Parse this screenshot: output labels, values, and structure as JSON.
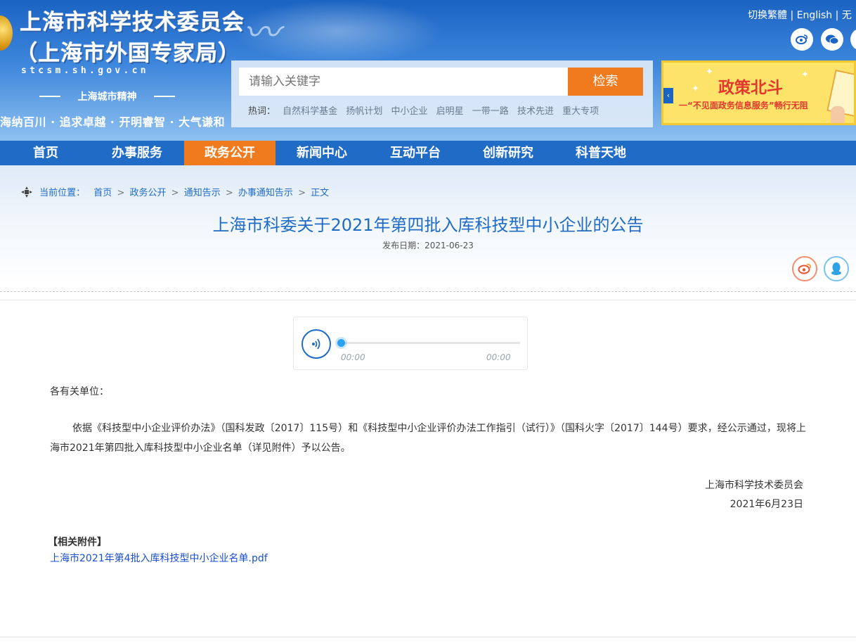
{
  "header": {
    "org_name": "上海市科学技术委员会",
    "org_sub": "（上海市外国专家局）",
    "domain": "stcsm.sh.gov.cn",
    "spirit_title": "上海城市精神",
    "spirit_text": "海纳百川 · 追求卓越 · 开明睿智 · 大气谦和",
    "links": [
      "切换繁體",
      "English",
      "无"
    ],
    "social_icons": [
      "weibo-icon",
      "wechat-icon"
    ]
  },
  "search": {
    "placeholder": "请输入关键字",
    "button_label": "检索",
    "hot_label": "热词：",
    "hot_words": [
      "自然科学基金",
      "扬帆计划",
      "中小企业",
      "启明星",
      "一带一路",
      "技术先进",
      "重大专项"
    ]
  },
  "banner": {
    "title": "政策北斗",
    "subtitle": "一“不见面政务信息服务”畅行无阻"
  },
  "nav": {
    "items": [
      "首页",
      "办事服务",
      "政务公开",
      "新闻中心",
      "互动平台",
      "创新研究",
      "科普天地"
    ],
    "active_index": 2
  },
  "breadcrumb": {
    "label": "当前位置：",
    "items": [
      "首页",
      "政务公开",
      "通知告示",
      "办事通知告示",
      "正文"
    ]
  },
  "article": {
    "title": "上海市科委关于2021年第四批入库科技型中小企业的公告",
    "publish_date": "发布日期：2021-06-23",
    "audio": {
      "current": "00:00",
      "total": "00:00",
      "progress": 0
    },
    "salutation": "各有关单位：",
    "paragraph": "依据《科技型中小企业评价办法》（国科发政〔2017〕115号）和《科技型中小企业评价办法工作指引（试行）》（国科火字〔2017〕144号）要求，经公示通过，现将上海市2021年第四批入库科技型中小企业名单（详见附件）予以公告。",
    "sign_org": "上海市科学技术委员会",
    "sign_date": "2021年6月23日",
    "attachment_label": "【相关附件】",
    "attachment_link": "上海市2021年第4批入库科技型中小企业名单.pdf"
  },
  "colors": {
    "nav_bg": "#1f6bc6",
    "accent_orange": "#f07b1e",
    "title_blue": "#1f6bc6",
    "link_blue": "#1a4fd0"
  }
}
